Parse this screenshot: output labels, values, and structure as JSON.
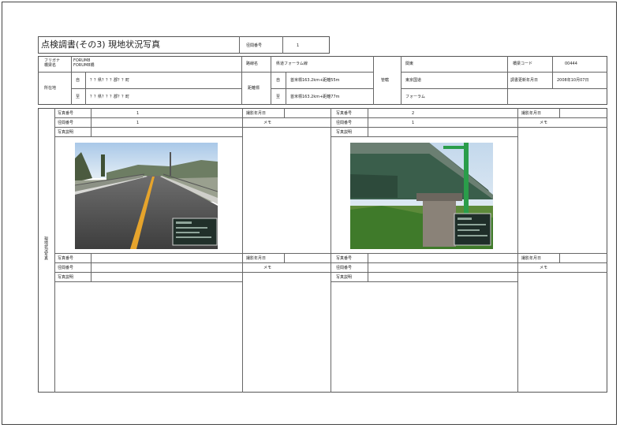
{
  "title": "点検調書(その3) 現地状況写真",
  "header": {
    "bridge_no_label": "径間番号",
    "bridge_no_value": "1"
  },
  "info": {
    "furigana_label": "フリガナ",
    "name_label": "橋梁名",
    "furigana_value": "FORUM8",
    "name_value": "FORUM8橋",
    "route_name_label": "路線名",
    "route_name_value": "県道フォーラム線",
    "location_label": "所在地",
    "from_label": "自",
    "to_label": "至",
    "location_from": "？？県？？？郡？？町",
    "location_to": "？？県？？？郡？？町",
    "distance_label": "距離標",
    "distance_from": "首米標163.2km+距離55m",
    "distance_to": "首米標163.2km+距離77m",
    "admin_label": "管轄",
    "admin_1": "関東",
    "admin_2": "東京国道",
    "admin_3": "フォーラム",
    "bridge_code_label": "橋梁コード",
    "bridge_code_value": "00444",
    "update_label": "調書更新年月日",
    "update_value": "2008年10月07日"
  },
  "side_label": "現地状況写真",
  "cells": [
    {
      "photo_no_label": "写真番号",
      "photo_no": "1",
      "span_no_label": "径間番号",
      "span_no": "1",
      "desc_label": "写真説明",
      "date_label": "撮影年月日",
      "memo_label": "メモ"
    },
    {
      "photo_no_label": "写真番号",
      "photo_no": "2",
      "span_no_label": "径間番号",
      "span_no": "1",
      "desc_label": "写真説明",
      "date_label": "撮影年月日",
      "memo_label": "メモ"
    },
    {
      "photo_no_label": "写真番号",
      "photo_no": "",
      "span_no_label": "径間番号",
      "span_no": "",
      "desc_label": "写真説明",
      "date_label": "撮影年月日",
      "memo_label": "メモ"
    },
    {
      "photo_no_label": "写真番号",
      "photo_no": "",
      "span_no_label": "径間番号",
      "span_no": "",
      "desc_label": "写真説明",
      "date_label": "撮影年月日",
      "memo_label": "メモ"
    }
  ],
  "photos": [
    "road-bridge-deck-photo",
    "bridge-underside-photo"
  ]
}
